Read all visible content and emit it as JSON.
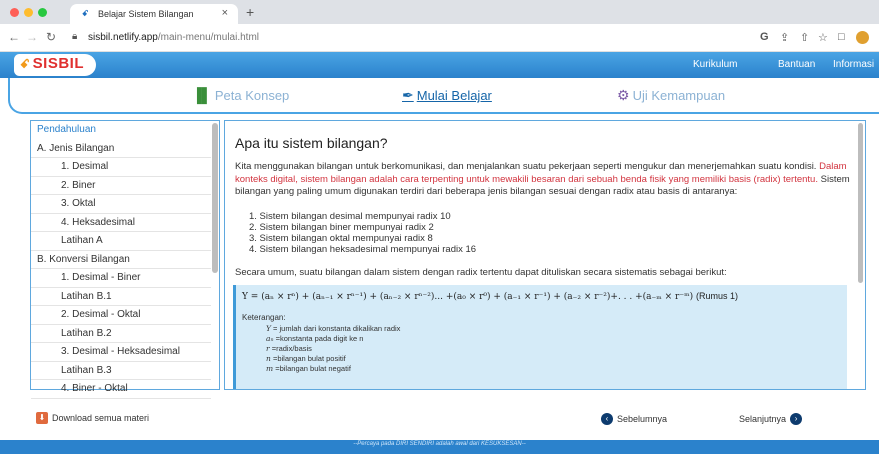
{
  "browser": {
    "tab_title": "Belajar Sistem Bilangan",
    "tab_favicon": "ꗃ",
    "tab_close": "×",
    "new_tab": "+",
    "url_host": "sisbil.netlify.app",
    "url_path": "/main-menu/mulai.html",
    "icons": [
      "back-icon",
      "forward-icon",
      "reload-icon",
      "lock-icon",
      "google-icon",
      "share-icon",
      "star-icon",
      "window-icon",
      "profile-icon"
    ]
  },
  "site": {
    "logo_icon": "ꗃ",
    "logo_text": "SISBIL",
    "menu": [
      "Kurikulum",
      "Bantuan",
      "Informasi"
    ]
  },
  "nav": [
    {
      "label": "Peta Konsep",
      "icon": "chart-icon"
    },
    {
      "label": "Mulai Belajar",
      "icon": "feather-icon"
    },
    {
      "label": "Uji Kemampuan",
      "icon": "gear-icon"
    }
  ],
  "sidebar": {
    "items": [
      "Pendahuluan",
      "A. Jenis Bilangan",
      "1. Desimal",
      "2. Biner",
      "3. Oktal",
      "4. Heksadesimal",
      "Latihan A",
      "B. Konversi Bilangan",
      "1. Desimal - Biner",
      "Latihan B.1",
      "2. Desimal - Oktal",
      "Latihan B.2",
      "3. Desimal - Heksadesimal",
      "Latihan B.3",
      "4. Biner - Oktal"
    ]
  },
  "content": {
    "title": "Apa itu sistem bilangan?",
    "p1_a": "Kita menggunakan bilangan untuk berkomunikasi, dan menjalankan suatu pekerjaan seperti mengukur dan menerjemahkan suatu kondisi.",
    "p1_red": "Dalam konteks digital, sistem bilangan adalah cara terpenting untuk mewakili besaran dari sebuah benda fisik yang memiliki basis (radix) tertentu.",
    "p1_b": "Sistem bilangan yang paling umum digunakan terdiri dari beberapa jenis bilangan sesuai dengan radix atau basis di antaranya:",
    "list": [
      "1. Sistem bilangan desimal mempunyai radix 10",
      "2. Sistem bilangan biner mempunyai radix 2",
      "3. Sistem bilangan oktal mempunyai radix 8",
      "4. Sistem bilangan heksadesimal mempunyai radix 16"
    ],
    "p2": "Secara umum, suatu bilangan dalam sistem dengan radix tertentu dapat dituliskan secara sistematis sebagai berikut:",
    "formula": "Y = (aₙ × rⁿ) + (aₙ₋₁ × rⁿ⁻¹) + (aₙ₋₂ × rⁿ⁻²)... +(a₀ × r⁰) + (a₋₁ × r⁻¹) + (a₋₂ × r⁻²)+. . . +(a₋ₘ × r⁻ᵐ)",
    "formula_label": "(Rumus 1)",
    "keterangan": "Keterangan:",
    "legend": [
      {
        "sym": "Y",
        "desc": "= jumlah dari konstanta dikalikan radix"
      },
      {
        "sym": "aₙ",
        "desc": "=konstanta pada digit ke n"
      },
      {
        "sym": "r",
        "desc": "=radix/basis"
      },
      {
        "sym": "n",
        "desc": "=bilangan bulat positif"
      },
      {
        "sym": "m",
        "desc": "=bilangan bulat negatif"
      }
    ]
  },
  "footer": {
    "download": "Download semua materi",
    "prev": "Sebelumnya",
    "next": "Selanjutnya",
    "tagline": "--Percaya pada DIRI SENDIRI adalah awal dari KESUKSESAN--"
  },
  "colors": {
    "accent": "#2b82cc",
    "red_text": "#d2343f",
    "formula_bg": "#d5ebf8"
  }
}
